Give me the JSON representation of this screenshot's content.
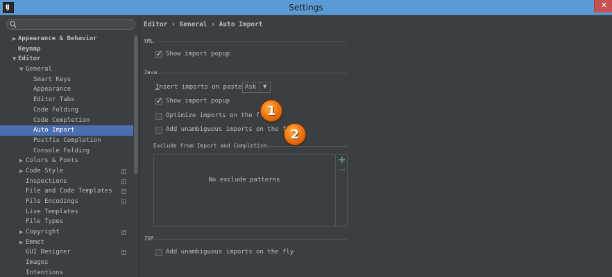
{
  "window": {
    "title": "Settings",
    "app_icon_text": "IJ",
    "close_label": "✕"
  },
  "search": {
    "placeholder": "",
    "value": ""
  },
  "tree": [
    {
      "label": "Appearance & Behavior",
      "level": 0,
      "arrow": "▶",
      "bold": true,
      "selected": false,
      "project_icon": false
    },
    {
      "label": "Keymap",
      "level": 0,
      "arrow": "",
      "bold": true,
      "selected": false,
      "project_icon": false
    },
    {
      "label": "Editor",
      "level": 0,
      "arrow": "▼",
      "bold": true,
      "selected": false,
      "project_icon": false
    },
    {
      "label": "General",
      "level": 1,
      "arrow": "▼",
      "bold": false,
      "selected": false,
      "project_icon": false
    },
    {
      "label": "Smart Keys",
      "level": 2,
      "arrow": "",
      "bold": false,
      "selected": false,
      "project_icon": false
    },
    {
      "label": "Appearance",
      "level": 2,
      "arrow": "",
      "bold": false,
      "selected": false,
      "project_icon": false
    },
    {
      "label": "Editor Tabs",
      "level": 2,
      "arrow": "",
      "bold": false,
      "selected": false,
      "project_icon": false
    },
    {
      "label": "Code Folding",
      "level": 2,
      "arrow": "",
      "bold": false,
      "selected": false,
      "project_icon": false
    },
    {
      "label": "Code Completion",
      "level": 2,
      "arrow": "",
      "bold": false,
      "selected": false,
      "project_icon": false
    },
    {
      "label": "Auto Import",
      "level": 2,
      "arrow": "",
      "bold": false,
      "selected": true,
      "project_icon": false
    },
    {
      "label": "Postfix Completion",
      "level": 2,
      "arrow": "",
      "bold": false,
      "selected": false,
      "project_icon": false
    },
    {
      "label": "Console Folding",
      "level": 2,
      "arrow": "",
      "bold": false,
      "selected": false,
      "project_icon": false
    },
    {
      "label": "Colors & Fonts",
      "level": 1,
      "arrow": "▶",
      "bold": false,
      "selected": false,
      "project_icon": false
    },
    {
      "label": "Code Style",
      "level": 1,
      "arrow": "▶",
      "bold": false,
      "selected": false,
      "project_icon": true
    },
    {
      "label": "Inspections",
      "level": 1,
      "arrow": "",
      "bold": false,
      "selected": false,
      "project_icon": true
    },
    {
      "label": "File and Code Templates",
      "level": 1,
      "arrow": "",
      "bold": false,
      "selected": false,
      "project_icon": true
    },
    {
      "label": "File Encodings",
      "level": 1,
      "arrow": "",
      "bold": false,
      "selected": false,
      "project_icon": true
    },
    {
      "label": "Live Templates",
      "level": 1,
      "arrow": "",
      "bold": false,
      "selected": false,
      "project_icon": false
    },
    {
      "label": "File Types",
      "level": 1,
      "arrow": "",
      "bold": false,
      "selected": false,
      "project_icon": false
    },
    {
      "label": "Copyright",
      "level": 1,
      "arrow": "▶",
      "bold": false,
      "selected": false,
      "project_icon": true
    },
    {
      "label": "Emmet",
      "level": 1,
      "arrow": "▶",
      "bold": false,
      "selected": false,
      "project_icon": false
    },
    {
      "label": "GUI Designer",
      "level": 1,
      "arrow": "",
      "bold": false,
      "selected": false,
      "project_icon": true
    },
    {
      "label": "Images",
      "level": 1,
      "arrow": "",
      "bold": false,
      "selected": false,
      "project_icon": false
    },
    {
      "label": "Intentions",
      "level": 1,
      "arrow": "",
      "bold": false,
      "selected": false,
      "project_icon": false
    }
  ],
  "breadcrumb": {
    "text": "Editor › General › Auto Import"
  },
  "xml": {
    "title": "XML",
    "show_import_popup": {
      "label": "Show import popup",
      "checked": true
    }
  },
  "java": {
    "title": "Java",
    "insert_on_paste": {
      "label_prefix": "I",
      "label_rest": "nsert imports on paste:",
      "value": "Ask"
    },
    "show_import_popup": {
      "label": "Show import popup",
      "checked": true
    },
    "optimize_on_fly": {
      "label": "Optimize imports on the fly",
      "checked": false
    },
    "add_unambiguous": {
      "label": "Add unambiguous imports on the fly",
      "checked": false
    }
  },
  "badges": {
    "first": "1",
    "second": "2"
  },
  "exclude": {
    "title": "Exclude from Import and Completion",
    "empty_text": "No exclude patterns",
    "add_label": "+",
    "remove_label": "−"
  },
  "jsp": {
    "title": "JSP",
    "add_unambiguous": {
      "label": "Add unambiguous imports on the fly",
      "checked": false
    }
  },
  "colors": {
    "titlebar": "#5b9bd5",
    "selection": "#4b6eaf",
    "background": "#3c3f41",
    "badge": "#f07a14",
    "add_icon": "#59a869"
  }
}
